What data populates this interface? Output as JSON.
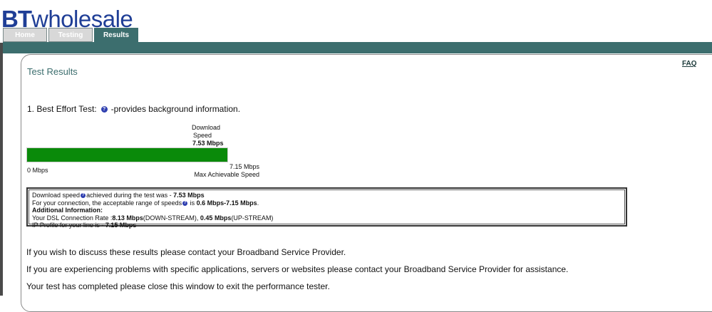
{
  "header": {
    "logo_bt": "BT",
    "logo_wholesale": "wholesale",
    "tabs": [
      {
        "label": "Home",
        "active": false
      },
      {
        "label": "Testing",
        "active": false
      },
      {
        "label": "Results",
        "active": true
      }
    ],
    "faq_label": "FAQ"
  },
  "main": {
    "title": "Test Results",
    "test": {
      "heading": "1. Best Effort Test:",
      "description": "-provides background information."
    },
    "gauge": {
      "label_line1": "Download",
      "label_line2": "Speed",
      "value_label": "7.53 Mbps",
      "min_label": "0 Mbps",
      "max_value_label": "7.15 Mbps",
      "max_caption": "Max Achievable Speed",
      "fill_fraction": 1.0
    },
    "info": {
      "line1_prefix": "Download speed",
      "line1_mid": "achieved during the test was - ",
      "line1_value": "7.53 Mbps",
      "line2_prefix": "For your connection, the acceptable range of speeds",
      "line2_mid": " is ",
      "line2_value": "0.6 Mbps-7.15 Mbps",
      "line2_suffix": ".",
      "additional_heading": "Additional Information:",
      "line3_prefix": "Your DSL Connection Rate :",
      "line3_down_value": "8.13 Mbps",
      "line3_down_label": "(DOWN-STREAM), ",
      "line3_up_value": "0.45 Mbps",
      "line3_up_label": "(UP-STREAM)",
      "line4_prefix": "IP Profile for your line is - ",
      "line4_value": "7.15 Mbps"
    },
    "paragraphs": [
      "If you wish to discuss these results please contact your Broadband Service Provider.",
      "If you are experiencing problems with specific applications, servers or websites please contact your Broadband Service Provider for assistance.",
      "Your test has completed please close this window to exit the performance tester."
    ]
  },
  "colors": {
    "brand_blue": "#1f3e96",
    "teal": "#3c6e6e",
    "bar_green": "#0a8a0a"
  }
}
